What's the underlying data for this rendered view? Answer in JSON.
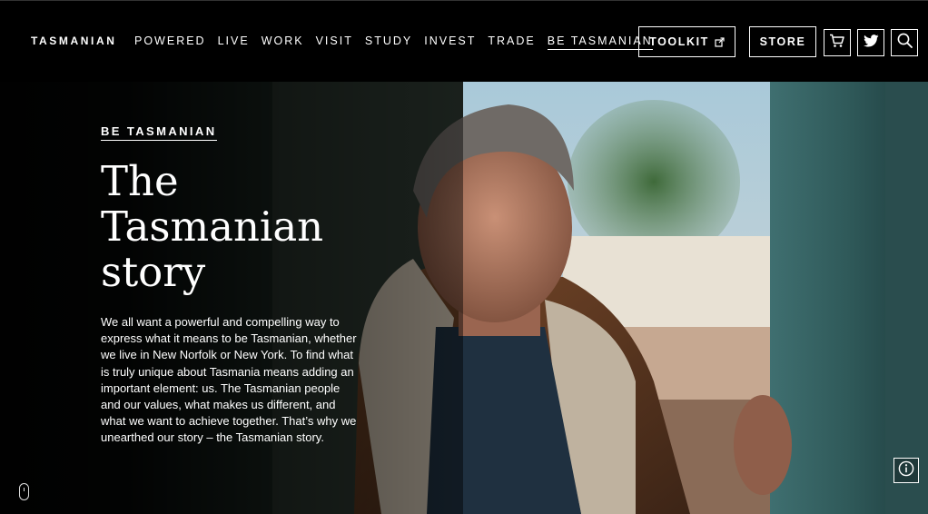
{
  "header": {
    "brand": "TASMANIAN",
    "nav": [
      {
        "label": "POWERED"
      },
      {
        "label": "LIVE"
      },
      {
        "label": "WORK"
      },
      {
        "label": "VISIT"
      },
      {
        "label": "STUDY"
      },
      {
        "label": "INVEST"
      },
      {
        "label": "TRADE"
      },
      {
        "label": "BE TASMANIAN",
        "active": true
      }
    ],
    "toolkit_label": "TOOLKIT",
    "store_label": "STORE",
    "icons": [
      "cart-icon",
      "twitter-icon",
      "search-icon",
      "external-link-icon"
    ]
  },
  "hero": {
    "eyebrow": "BE TASMANIAN",
    "title_lines": [
      "The",
      "Tasmanian",
      "story"
    ],
    "body": "We all want a powerful and compelling way to express what it means to be Tasmanian, whether we live in New Norfolk or New York. To find what is truly unique about Tasmania means adding an important element: us. The Tasmanian people and our values, what makes us different, and what we want to achieve together. That’s why we unearthed our story – the Tasmanian story.",
    "icons": [
      "mouse-scroll-icon",
      "info-icon"
    ]
  },
  "colors": {
    "background": "#000000",
    "text": "#ffffff"
  }
}
